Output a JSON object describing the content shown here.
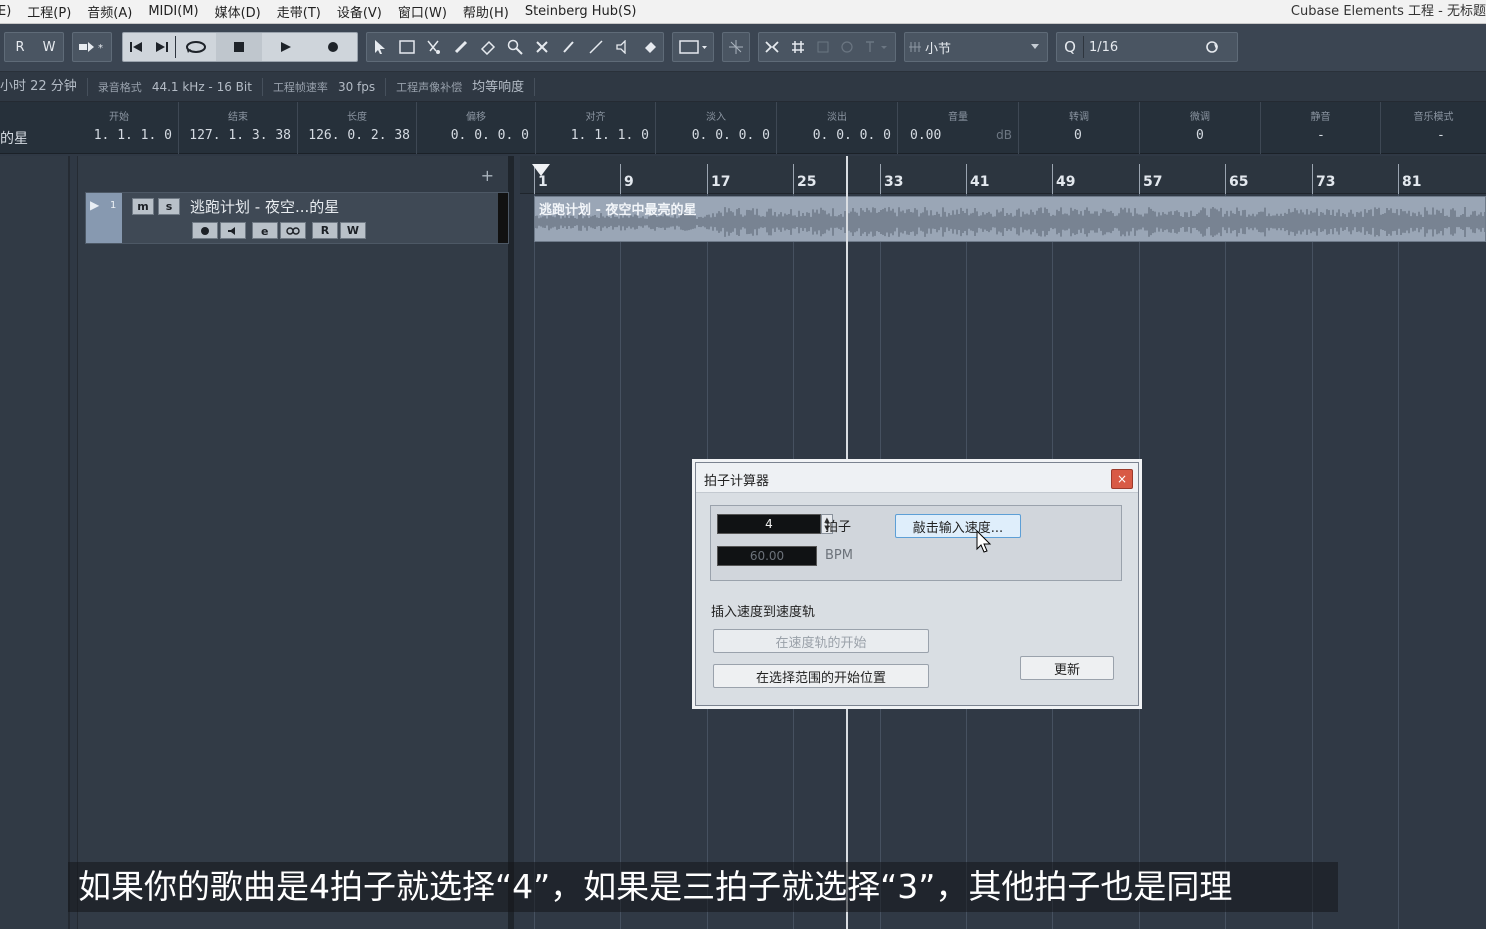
{
  "menubar": {
    "items": [
      "E)",
      "工程(P)",
      "音频(A)",
      "MIDI(M)",
      "媒体(D)",
      "走带(T)",
      "设备(V)",
      "窗口(W)",
      "帮助(H)",
      "Steinberg Hub(S)"
    ],
    "app_title": "Cubase Elements 工程 - 无标题"
  },
  "toolbar": {
    "r_label": "R",
    "w_label": "W",
    "quantize_label": "Q",
    "quantize_value": "1/16",
    "grid_label": "小节"
  },
  "infobar": {
    "duration": "小时 22 分钟",
    "record_format_label": "录音格式",
    "record_format": "44.1 kHz - 16 Bit",
    "frame_rate_label": "工程帧速率",
    "frame_rate": "30 fps",
    "pan_law_label": "工程声像补偿",
    "pan_law": "均等响度"
  },
  "params": {
    "track_name_short": "的星",
    "start_label": "开始",
    "start": "1. 1. 1.   0",
    "end_label": "结束",
    "end": "127. 1. 3. 38",
    "length_label": "长度",
    "length": "126. 0. 2. 38",
    "offset_label": "偏移",
    "offset": "0. 0. 0.   0",
    "snap_label": "对齐",
    "snap": "1. 1. 1.   0",
    "fadein_label": "淡入",
    "fadein": "0. 0. 0.   0",
    "fadeout_label": "淡出",
    "fadeout": "0. 0. 0.   0",
    "volume_label": "音量",
    "volume": "0.00",
    "volume_unit": "dB",
    "transpose_label": "转调",
    "transpose": "0",
    "finetune_label": "微调",
    "finetune": "0",
    "mute_label": "静音",
    "mute": "-",
    "musical_label": "音乐模式",
    "musical": "-"
  },
  "tracklist": {
    "add_label": "+",
    "track_number": "1",
    "track_title": "逃跑计划 - 夜空...的星",
    "m_label": "m",
    "s_label": "s",
    "r_label": "R",
    "w_label": "W"
  },
  "arrange": {
    "ruler": [
      "1",
      "9",
      "17",
      "25",
      "33",
      "41",
      "49",
      "57",
      "65",
      "73",
      "81"
    ],
    "clip_title": "逃跑计划 - 夜空中最亮的星"
  },
  "dialog": {
    "title": "拍子计算器",
    "beats_value": "4",
    "beats_label": "拍子",
    "bpm_value": "60.00",
    "bpm_label": "BPM",
    "tap_button": "敲击输入速度...",
    "insert_label": "插入速度到速度轨",
    "btn_at_tempo_start": "在速度轨的开始",
    "btn_at_selection_start": "在选择范围的开始位置",
    "btn_update": "更新",
    "close_glyph": "×"
  },
  "subtitle": "如果你的歌曲是4拍子就选择“4”，如果是三拍子就选择“3”，其他拍子也是同理"
}
